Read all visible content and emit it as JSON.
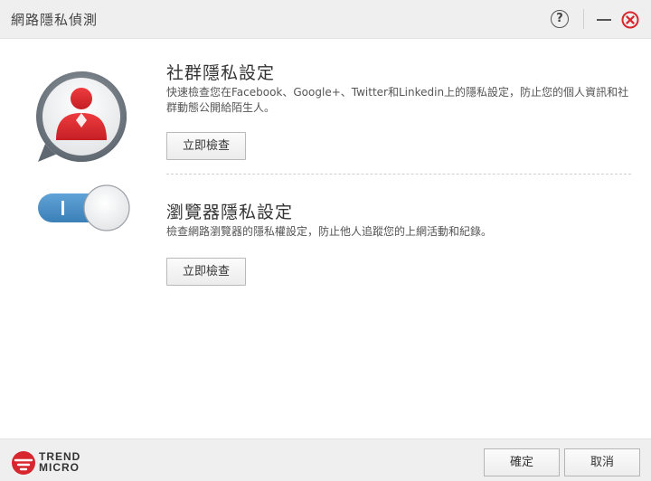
{
  "window": {
    "title": "網路隱私偵測",
    "help_label": "?"
  },
  "social": {
    "title": "社群隱私設定",
    "description": "快速檢查您在Facebook、Google+、Twitter和Linkedin上的隱私設定，防止您的個人資訊和社群動態公開給陌生人。",
    "button_label": "立即檢查"
  },
  "browser": {
    "title": "瀏覽器隱私設定",
    "description": "檢查網路瀏覽器的隱私權設定，防止他人追蹤您的上網活動和紀錄。",
    "button_label": "立即檢查",
    "toggle_label": "I"
  },
  "footer": {
    "logo_line1": "TREND",
    "logo_line2": "MICRO",
    "ok_label": "確定",
    "cancel_label": "取消"
  },
  "colors": {
    "accent_red": "#d8262e",
    "toggle_blue": "#4a90c9",
    "titlebar_bg": "#efefef"
  }
}
